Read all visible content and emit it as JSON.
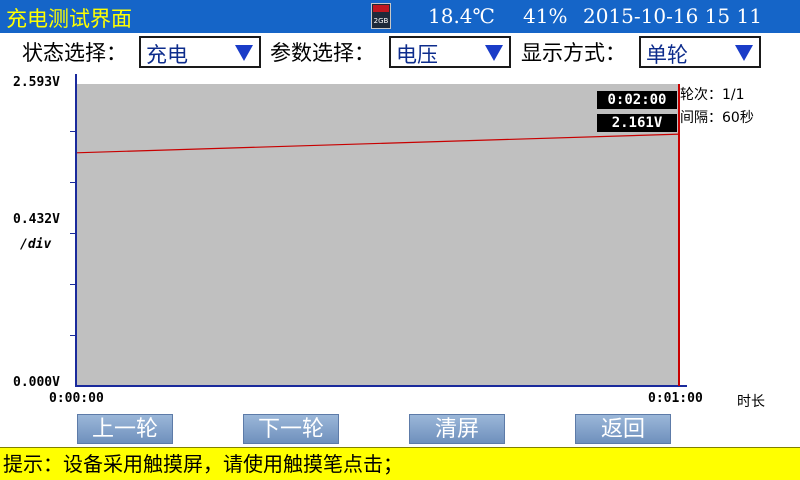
{
  "titlebar": {
    "title": "充电测试界面",
    "sd_label": "2GB",
    "temperature": "18.4℃",
    "battery": "41%",
    "datetime": "2015-10-16 15 11"
  },
  "selectors": {
    "state_label": "状态选择：",
    "state_value": "充电",
    "param_label": "参数选择：",
    "param_value": "电压",
    "display_label": "显示方式：",
    "display_value": "单轮"
  },
  "chart": {
    "y_max_label": "2.593V",
    "y_mid_label": "0.432V",
    "y_div_label": "/div",
    "y_min_label": "0.000V",
    "x_start_label": "0:00:00",
    "x_end_label": "0:01:00",
    "x_axis_label": "时长",
    "cursor_time": "0:02:00",
    "cursor_value": "2.161V",
    "round_info": "轮次：1/1",
    "interval_info": "间隔：60秒",
    "colors": {
      "plot_bg": "#c0c0c0",
      "line": "#c80000",
      "axis": "#1a2a9c"
    }
  },
  "chart_data": {
    "type": "line",
    "ylim": [
      0,
      2.593
    ],
    "series": [
      {
        "x": [
          0,
          60
        ],
        "values": [
          2.0,
          2.161
        ]
      }
    ]
  },
  "buttons": {
    "prev": "上一轮",
    "next": "下一轮",
    "clear": "清屏",
    "back": "返回"
  },
  "hint": "提示：设备采用触摸屏，请使用触摸笔点击；"
}
